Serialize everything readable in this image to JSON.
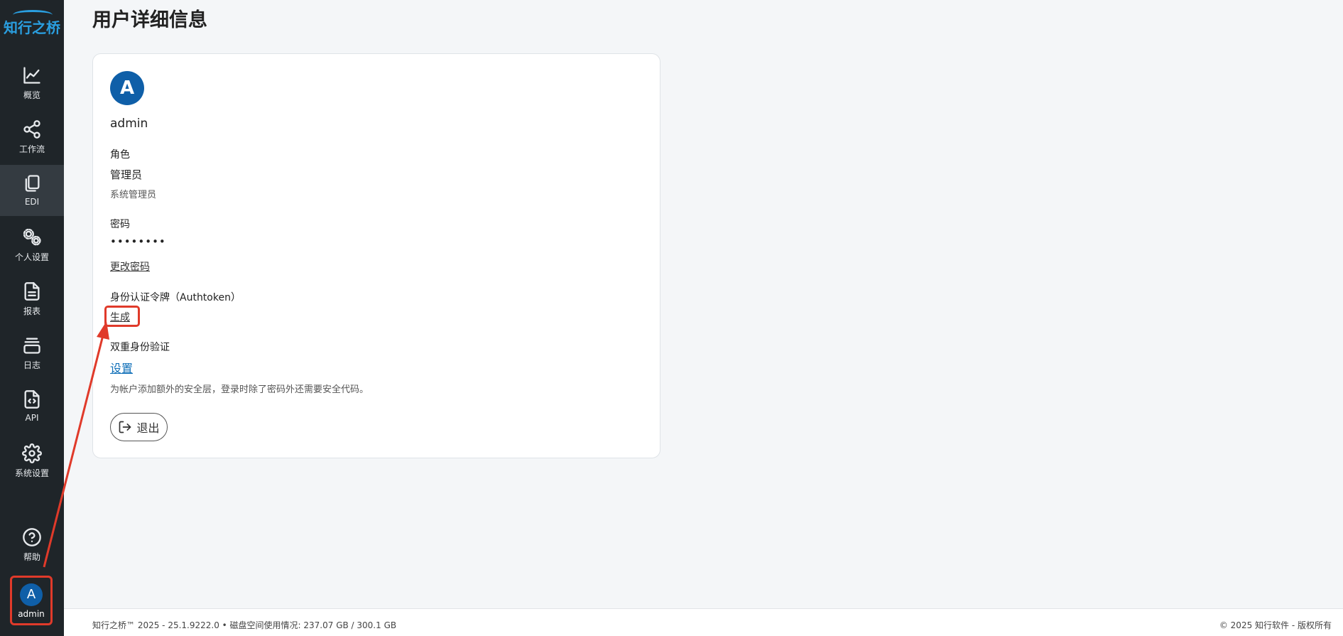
{
  "app": {
    "logo_text": "知行之桥"
  },
  "sidebar": {
    "items": [
      {
        "label": "概览",
        "icon": "line-chart-icon"
      },
      {
        "label": "工作流",
        "icon": "share-nodes-icon"
      },
      {
        "label": "EDI",
        "icon": "copy-documents-icon"
      },
      {
        "label": "个人设置",
        "icon": "gears-icon"
      },
      {
        "label": "报表",
        "icon": "file-text-icon"
      },
      {
        "label": "日志",
        "icon": "layers-icon"
      },
      {
        "label": "API",
        "icon": "file-code-icon"
      },
      {
        "label": "系统设置",
        "icon": "gear-icon"
      }
    ],
    "active_index": 2,
    "help_label": "帮助",
    "user": {
      "initial": "A",
      "name": "admin"
    }
  },
  "page": {
    "title": "用户详细信息"
  },
  "profile": {
    "initial": "A",
    "username": "admin",
    "role_label": "角色",
    "role_value": "管理员",
    "role_desc": "系统管理员",
    "password_label": "密码",
    "password_value": "••••••••",
    "change_password": "更改密码",
    "authtoken_label": "身份认证令牌（Authtoken）",
    "generate": "生成",
    "twofa_label": "双重身份验证",
    "twofa_setup": "设置",
    "twofa_desc": "为帐户添加额外的安全层，登录时除了密码外还需要安全代码。",
    "logout": "退出"
  },
  "footer": {
    "left": "知行之桥™ 2025 - 25.1.9222.0  •  磁盘空间使用情况:   237.07 GB / 300.1 GB",
    "right": "© 2025 知行软件 - 版权所有"
  },
  "colors": {
    "accent": "#0f5fa8",
    "highlight": "#e03a2a",
    "sidebar_bg": "#1f2529"
  }
}
